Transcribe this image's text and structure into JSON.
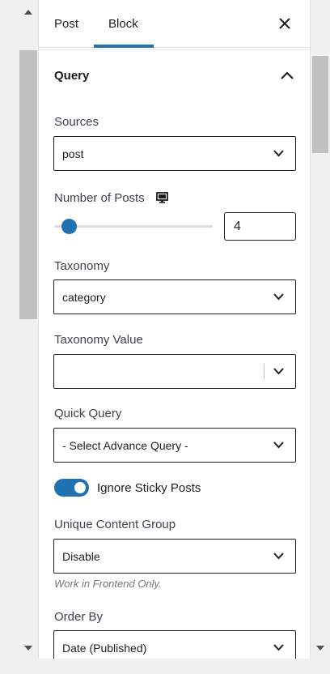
{
  "tabs": {
    "post_label": "Post",
    "block_label": "Block",
    "active": "Block"
  },
  "section": {
    "title": "Query",
    "expanded": true
  },
  "fields": {
    "sources": {
      "label": "Sources",
      "value": "post"
    },
    "number_of_posts": {
      "label": "Number of Posts",
      "value": "4",
      "min": 1,
      "max": 100
    },
    "taxonomy": {
      "label": "Taxonomy",
      "value": "category"
    },
    "taxonomy_value": {
      "label": "Taxonomy Value",
      "value": ""
    },
    "quick_query": {
      "label": "Quick Query",
      "value": "- Select Advance Query -"
    },
    "ignore_sticky": {
      "label": "Ignore Sticky Posts",
      "checked": true
    },
    "unique_content_group": {
      "label": "Unique Content Group",
      "value": "Disable",
      "help": "Work in Frontend Only."
    },
    "order_by": {
      "label": "Order By",
      "value": "Date (Published)"
    }
  },
  "colors": {
    "accent": "#2271b1",
    "border": "#1e1e1e",
    "muted": "#757575"
  },
  "icons": {
    "close": "close-icon",
    "collapse": "chevron-up-icon",
    "dropdown": "chevron-down-icon",
    "device": "desktop-icon"
  }
}
